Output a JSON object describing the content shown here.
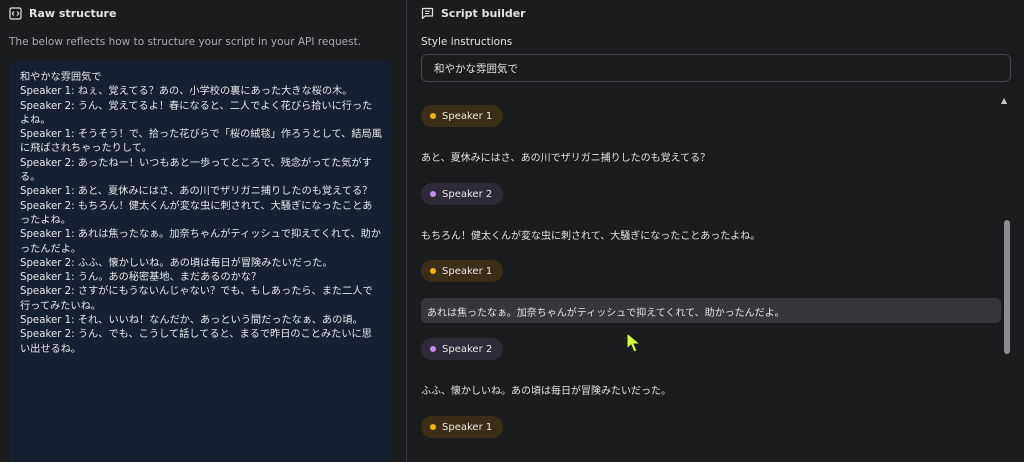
{
  "left_panel": {
    "title": "Raw structure",
    "icon": "code-brackets-icon",
    "description": "The below reflects how to structure your script in your API request.",
    "raw_lines": [
      "和やかな雰囲気で",
      "Speaker 1: ねぇ、覚えてる？あの、小学校の裏にあった大きな桜の木。",
      "Speaker 2: うん、覚えてるよ！春になると、二人でよく花びら拾いに行ったよね。",
      "Speaker 1: そうそう！で、拾った花びらで「桜の絨毯」作ろうとして、結局風に飛ばされちゃったりして。",
      "Speaker 2: あったねー！いつもあと一歩ってところで、残念がってた気がする。",
      "Speaker 1: あと、夏休みにはさ、あの川でザリガニ捕りしたのも覚えてる？",
      "Speaker 2: もちろん！健太くんが変な虫に刺されて、大騒ぎになったことあったよね。",
      "Speaker 1: あれは焦ったなぁ。加奈ちゃんがティッシュで抑えてくれて、助かったんだよ。",
      "Speaker 2: ふふ、懐かしいね。あの頃は毎日が冒険みたいだった。",
      "Speaker 1: うん。あの秘密基地、まだあるのかな？",
      "Speaker 2: さすがにもうないんじゃない？でも、もしあったら、また二人で行ってみたいね。",
      "Speaker 1: それ、いいね！なんだか、あっという間だったなぁ、あの頃。",
      "Speaker 2: うん、でも、こうして話してると、まるで昨日のことみたいに思い出せるね。"
    ]
  },
  "right_panel": {
    "title": "Script builder",
    "icon": "script-builder-icon",
    "style_label": "Style instructions",
    "style_value": "和やかな雰囲気で",
    "scroll_up_icon": "caret-up-icon",
    "entries": [
      {
        "speaker": "Speaker 1",
        "kind": "s1",
        "text": "あと、夏休みにはさ、あの川でザリガニ捕りしたのも覚えてる？"
      },
      {
        "speaker": "Speaker 2",
        "kind": "s2",
        "text": "もちろん！健太くんが変な虫に刺されて、大騒ぎになったことあったよね。"
      },
      {
        "speaker": "Speaker 1",
        "kind": "s1",
        "text": "あれは焦ったなぁ。加奈ちゃんがティッシュで抑えてくれて、助かったんだよ。",
        "hovered": true
      },
      {
        "speaker": "Speaker 2",
        "kind": "s2",
        "text": "ふふ、懐かしいね。あの頃は毎日が冒険みたいだった。"
      },
      {
        "speaker": "Speaker 1",
        "kind": "s1",
        "text": ""
      }
    ]
  },
  "colors": {
    "speaker1_dot": "#f4b400",
    "speaker2_dot": "#c58af9",
    "code_bg": "#152030",
    "cursor": "#d7ff2f"
  }
}
